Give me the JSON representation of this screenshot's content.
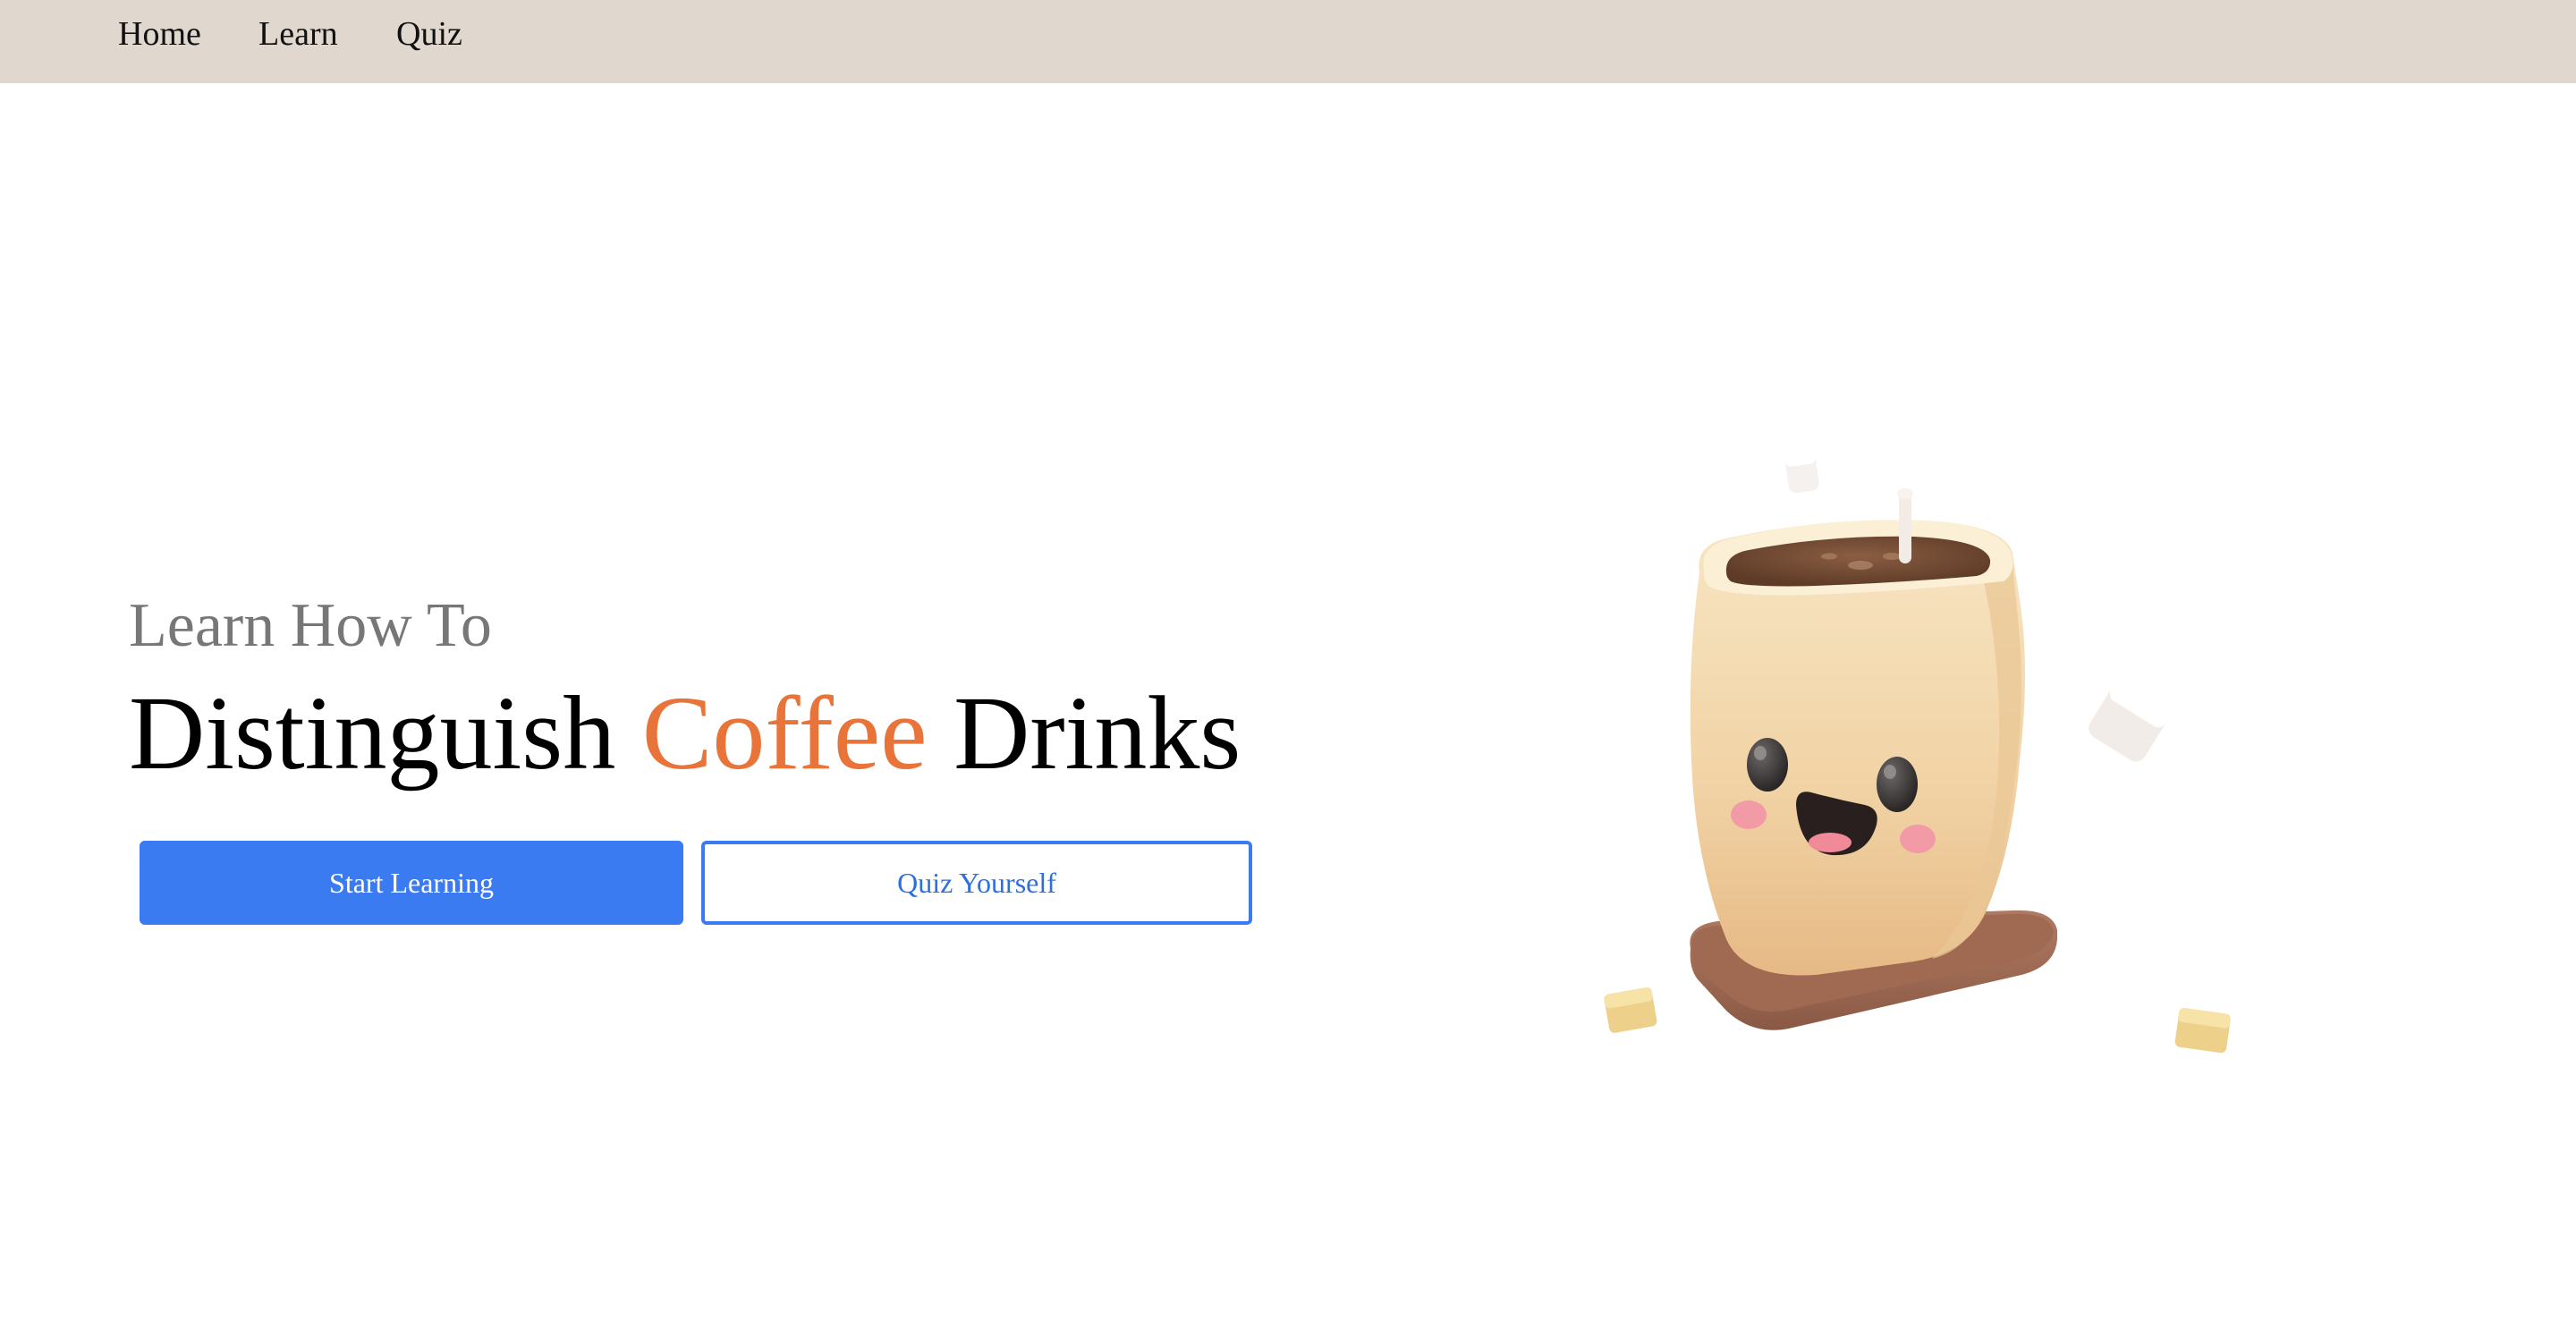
{
  "nav": {
    "items": [
      {
        "label": "Home"
      },
      {
        "label": "Learn"
      },
      {
        "label": "Quiz"
      }
    ]
  },
  "hero": {
    "subtitle": "Learn How To",
    "headline_part1": "Distinguish ",
    "headline_accent": "Coffee",
    "headline_part2": " Drinks",
    "primary_button": "Start Learning",
    "secondary_button": "Quiz Yourself",
    "illustration": "smiling-coffee-cup-icon"
  },
  "colors": {
    "nav_background": "#e0d8cf",
    "accent": "#e8743a",
    "primary_button": "#3a7bf2",
    "subtitle": "#777777"
  }
}
